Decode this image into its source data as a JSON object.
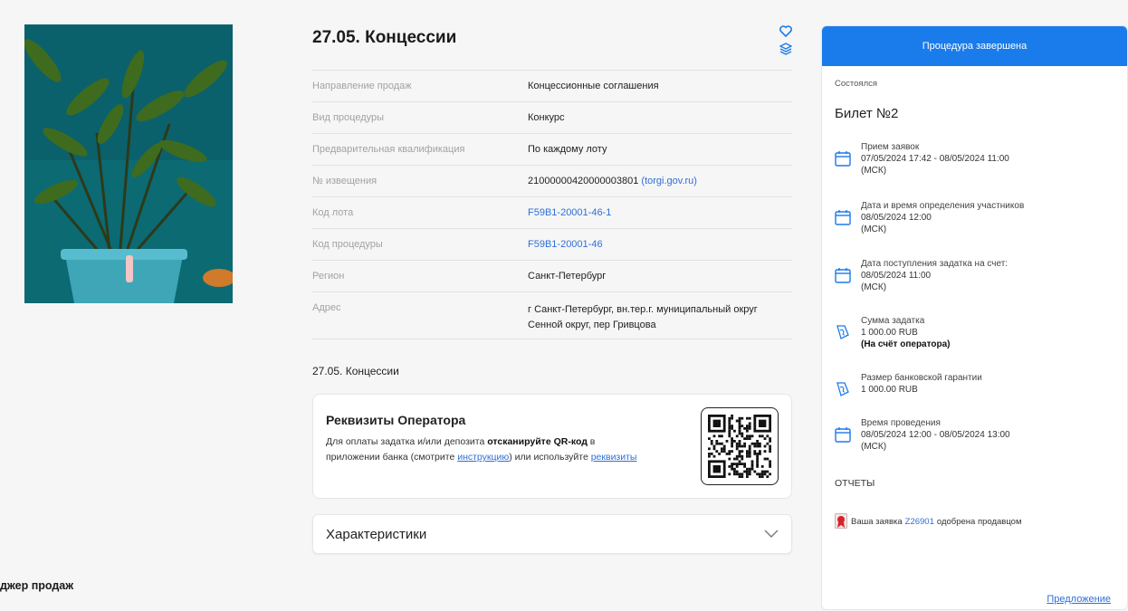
{
  "lot": {
    "title": "27.05. Концессии",
    "name": "27.05. Концессии"
  },
  "properties": [
    {
      "label": "Направление продаж",
      "value": "Концессионные соглашения"
    },
    {
      "label": "Вид процедуры",
      "value": "Конкурс"
    },
    {
      "label": "Предварительная квалификация",
      "value": "По каждому лоту"
    },
    {
      "label": "№ извещения",
      "value": "21000000420000003801",
      "link": "(torgi.gov.ru)"
    },
    {
      "label": "Код лота",
      "link": "F59B1-20001-46-1"
    },
    {
      "label": "Код процедуры",
      "link": "F59B1-20001-46"
    },
    {
      "label": "Регион",
      "value": "Санкт-Петербург"
    },
    {
      "label": "Адрес",
      "value": "г Санкт-Петербург, вн.тер.г. муниципальный округ Сенной округ, пер Гривцова"
    }
  ],
  "requisites": {
    "title": "Реквизиты Оператора",
    "text_1": "Для оплаты задатка и/или депозита ",
    "bold": "отсканируйте QR-код",
    "text_2": " в приложении банка (смотрите ",
    "instruction_link": "инструкцию",
    "text_3": ") или используйте ",
    "requisites_link": "реквизиты"
  },
  "characteristics": {
    "title": "Характеристики"
  },
  "sidebar": {
    "status": "Процедура завершена",
    "outcome": "Состоялся",
    "ticket": "Билет №2",
    "items": [
      {
        "icon": "calendar-icon",
        "label": "Прием заявок",
        "line1": "07/05/2024 17:42  - 08/05/2024 11:00",
        "line2": "(МСК)"
      },
      {
        "icon": "calendar-icon",
        "label": "Дата и время определения участников",
        "line1": "08/05/2024 12:00",
        "line2": "(МСК)"
      },
      {
        "icon": "calendar-icon",
        "label": "Дата поступления задатка на счет:",
        "line1": "08/05/2024 11:00",
        "line2": "(МСК)"
      },
      {
        "icon": "money-icon",
        "label": "Сумма задатка",
        "line1": "1 000.00 RUB",
        "line2": "(На счёт оператора)"
      },
      {
        "icon": "money-icon",
        "label": "Размер банковской гарантии",
        "line1": "1 000.00 RUB",
        "line2": ""
      },
      {
        "icon": "calendar-icon",
        "label": "Время проведения",
        "line1": "08/05/2024 12:00 - 08/05/2024 13:00",
        "line2": "(МСК)"
      }
    ],
    "reports": "ОТЧЕТЫ",
    "notice_prefix": "Ваша заявка",
    "notice_link": "Z26901",
    "notice_suffix": "одобрена продавцом",
    "bottom_link": "Предложение"
  },
  "footer": {
    "manager": "джер продаж"
  },
  "colors": {
    "accent": "#1a7bea",
    "link": "#2f6fd6"
  }
}
